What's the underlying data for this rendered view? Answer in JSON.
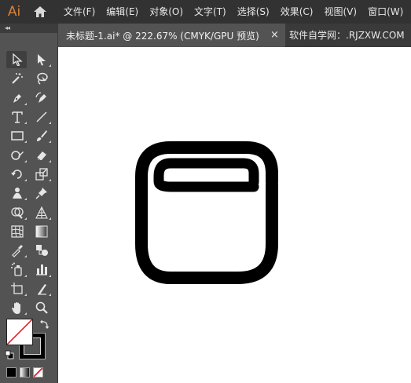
{
  "app": {
    "logo_text": "Ai"
  },
  "menubar": {
    "items": [
      "文件(F)",
      "编辑(E)",
      "对象(O)",
      "文字(T)",
      "选择(S)",
      "效果(C)",
      "视图(V)",
      "窗口(W)"
    ]
  },
  "tool_panel": {
    "collapse_label": "◂◂",
    "tools": [
      "selection-tool",
      "direct-selection-tool",
      "magic-wand-tool",
      "lasso-tool",
      "pen-tool",
      "curvature-tool",
      "type-tool",
      "line-segment-tool",
      "rectangle-tool",
      "paintbrush-tool",
      "shaper-tool",
      "eraser-tool",
      "rotate-tool",
      "scale-tool",
      "puppet-warp-tool",
      "pin-tool",
      "shape-builder-tool",
      "perspective-grid-tool",
      "mesh-tool",
      "gradient-tool",
      "eyedropper-tool",
      "blend-tool",
      "symbol-sprayer-tool",
      "column-graph-tool",
      "artboard-tool",
      "slice-tool",
      "hand-tool",
      "zoom-tool"
    ]
  },
  "document_tabs": {
    "active": {
      "title": "未标题-1.ai* @ 222.67% (CMYK/GPU 预览)",
      "close": "×"
    },
    "second": {
      "title": "软件自学网：.RJZXW.COM"
    }
  },
  "colors": {
    "accent": "#d7823a",
    "menubar_bg": "#323232",
    "panel_bg": "#535353",
    "canvas_bg": "#ffffff",
    "artwork_stroke": "#000000"
  }
}
